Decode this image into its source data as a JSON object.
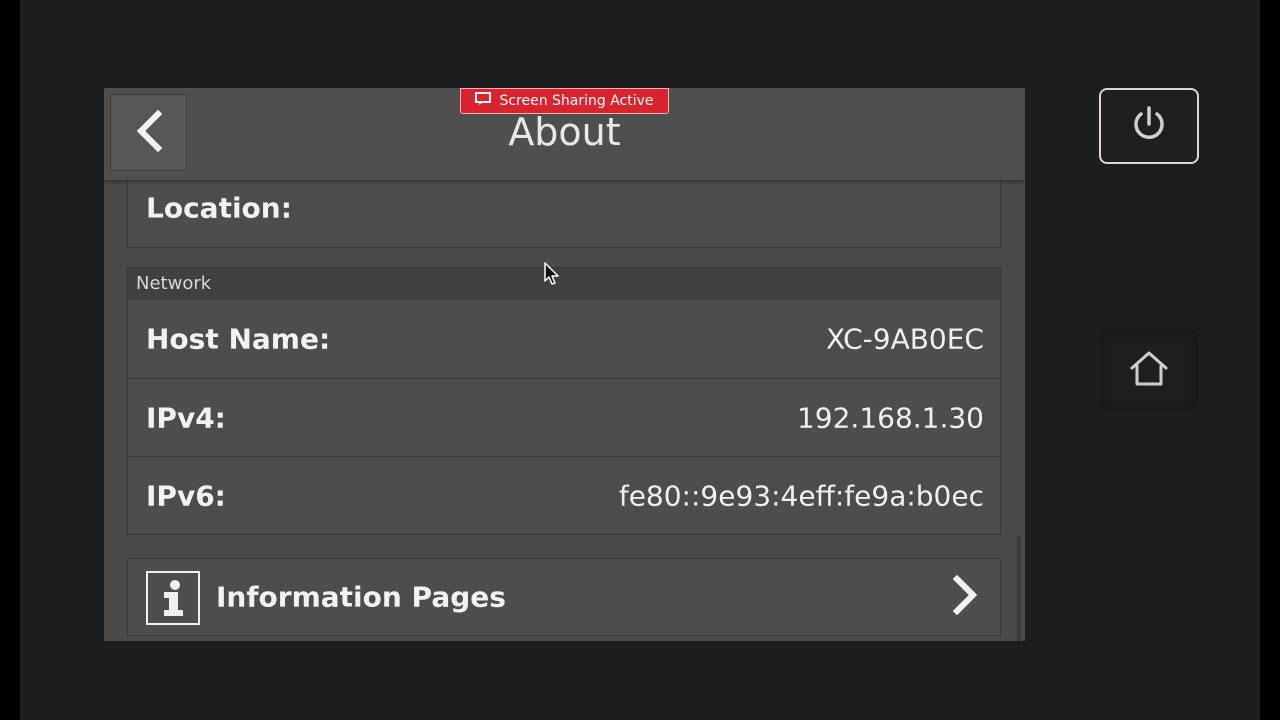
{
  "header": {
    "title": "About",
    "screen_sharing_badge": "Screen Sharing Active"
  },
  "location": {
    "label": "Location:",
    "value": ""
  },
  "network": {
    "section_title": "Network",
    "rows": [
      {
        "label": "Host Name:",
        "value": "XC-9AB0EC"
      },
      {
        "label": "IPv4:",
        "value": "192.168.1.30"
      },
      {
        "label": "IPv6:",
        "value": "fe80::9e93:4eff:fe9a:b0ec"
      }
    ]
  },
  "information_pages": {
    "label": "Information Pages"
  },
  "colors": {
    "badge_red": "#d9232e",
    "panel_gray": "#4a4a4a",
    "bezel": "#1c1d1e"
  },
  "icons": {
    "back": "chevron-left-icon",
    "info": "info-icon",
    "chevron": "chevron-right-icon",
    "power": "power-icon",
    "home": "home-icon",
    "screen_share": "screen-share-icon"
  }
}
